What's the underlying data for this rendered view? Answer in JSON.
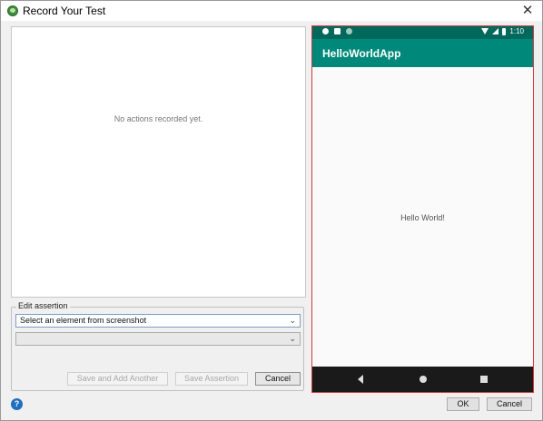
{
  "window": {
    "title": "Record Your Test",
    "close_glyph": "✕",
    "app_icon": "android-studio-icon"
  },
  "actions": {
    "empty_message": "No actions recorded yet."
  },
  "assertion": {
    "legend": "Edit assertion",
    "element_select_value": "Select an element from screenshot",
    "assertion_select_value": "",
    "save_add_label": "Save and Add Another",
    "save_label": "Save Assertion",
    "cancel_label": "Cancel"
  },
  "device": {
    "clock": "1:10",
    "app_title": "HelloWorldApp",
    "content_text": "Hello World!",
    "accent_color": "#00897b",
    "status_color": "#00695c"
  },
  "footer": {
    "help_glyph": "?",
    "ok_label": "OK",
    "cancel_label": "Cancel"
  }
}
